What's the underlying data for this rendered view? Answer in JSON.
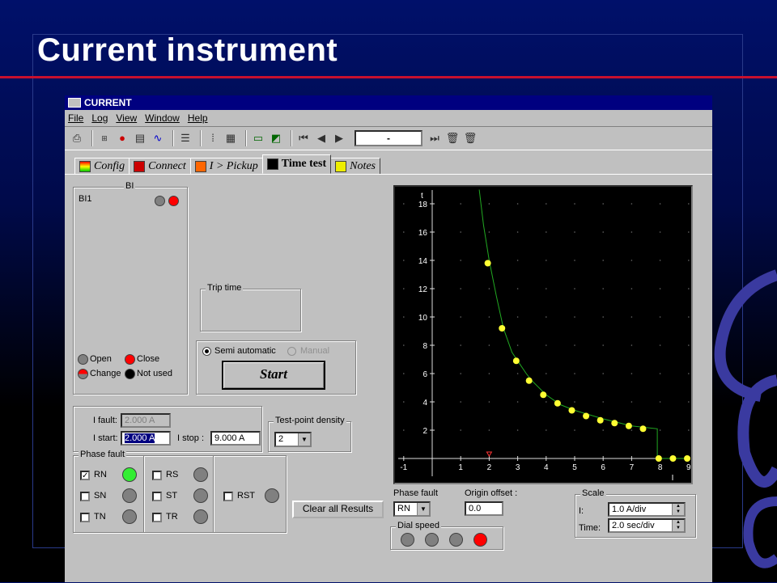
{
  "slide": {
    "title": "Current instrument"
  },
  "window": {
    "title": "CURRENT"
  },
  "menu": [
    "File",
    "Log",
    "View",
    "Window",
    "Help"
  ],
  "toolbar": {
    "field_value": "-"
  },
  "tabs": [
    {
      "label": "Config",
      "active": false
    },
    {
      "label": "Connect",
      "active": false
    },
    {
      "label": "I > Pickup",
      "active": false
    },
    {
      "label": "Time test",
      "active": true
    },
    {
      "label": "Notes",
      "active": false
    }
  ],
  "bi": {
    "group_label": "BI",
    "input_label": "BI1",
    "legend": {
      "open": "Open",
      "close": "Close",
      "change": "Change",
      "not_used": "Not used"
    }
  },
  "trip_time": {
    "label": "Trip time"
  },
  "mode": {
    "semi_auto": "Semi automatic",
    "manual": "Manual",
    "start": "Start"
  },
  "currents": {
    "i_fault_label": "I fault:",
    "i_fault_value": "2.000 A",
    "i_start_label": "I start:",
    "i_start_value": "2.000 A",
    "i_stop_label": "I stop :",
    "i_stop_value": "9.000 A"
  },
  "density": {
    "label": "Test-point density",
    "value": "2"
  },
  "phase_fault": {
    "label": "Phase fault",
    "phases": [
      {
        "name": "RN",
        "checked": true
      },
      {
        "name": "SN",
        "checked": false
      },
      {
        "name": "TN",
        "checked": false
      },
      {
        "name": "RS",
        "checked": false
      },
      {
        "name": "ST",
        "checked": false
      },
      {
        "name": "TR",
        "checked": false
      },
      {
        "name": "RST",
        "checked": false
      }
    ]
  },
  "clear_button": "Clear all Results",
  "chart_controls": {
    "phase_label": "Phase fault",
    "phase_value": "RN",
    "origin_label": "Origin offset :",
    "origin_value": "0.0",
    "dial_label": "Dial speed"
  },
  "scale": {
    "label": "Scale",
    "i_label": "I:",
    "i_value": "1.0 A/div",
    "time_label": "Time:",
    "time_value": "2.0 sec/div"
  },
  "colors": {
    "led_green": "#33ee33",
    "led_red": "#ff0000",
    "led_grey": "#808080",
    "curve": "#22aa22",
    "point": "#ffff33",
    "title_bar": "#000080",
    "accent_red": "#c8102e"
  },
  "chart_data": {
    "type": "scatter",
    "xlabel": "I",
    "ylabel": "t",
    "x_ticks": [
      "-1",
      "1",
      "2",
      "3",
      "4",
      "5",
      "6",
      "7",
      "8",
      "9"
    ],
    "y_ticks": [
      "2",
      "4",
      "6",
      "8",
      "10",
      "12",
      "14",
      "16",
      "18"
    ],
    "xlim": [
      -2,
      9
    ],
    "ylim": [
      -1,
      19.2
    ],
    "grid": true,
    "curve": [
      [
        1.65,
        19
      ],
      [
        1.8,
        16.5
      ],
      [
        2,
        14
      ],
      [
        2.25,
        11.5
      ],
      [
        2.5,
        9.2
      ],
      [
        2.8,
        7.5
      ],
      [
        3,
        6.9
      ],
      [
        3.3,
        6
      ],
      [
        3.5,
        5.5
      ],
      [
        4,
        4.5
      ],
      [
        4.5,
        3.8
      ],
      [
        5,
        3.4
      ],
      [
        6,
        2.8
      ],
      [
        7,
        2.3
      ],
      [
        7.9,
        2.1
      ],
      [
        7.9,
        0
      ],
      [
        9,
        0
      ]
    ],
    "points": [
      [
        1.95,
        13.8
      ],
      [
        2.45,
        9.2
      ],
      [
        2.95,
        6.9
      ],
      [
        3.4,
        5.5
      ],
      [
        3.9,
        4.5
      ],
      [
        4.4,
        3.9
      ],
      [
        4.9,
        3.4
      ],
      [
        5.4,
        3.0
      ],
      [
        5.9,
        2.7
      ],
      [
        6.4,
        2.5
      ],
      [
        6.9,
        2.3
      ],
      [
        7.4,
        2.1
      ],
      [
        7.95,
        0
      ],
      [
        8.45,
        0
      ],
      [
        8.95,
        0
      ]
    ],
    "marker_x": 2
  }
}
